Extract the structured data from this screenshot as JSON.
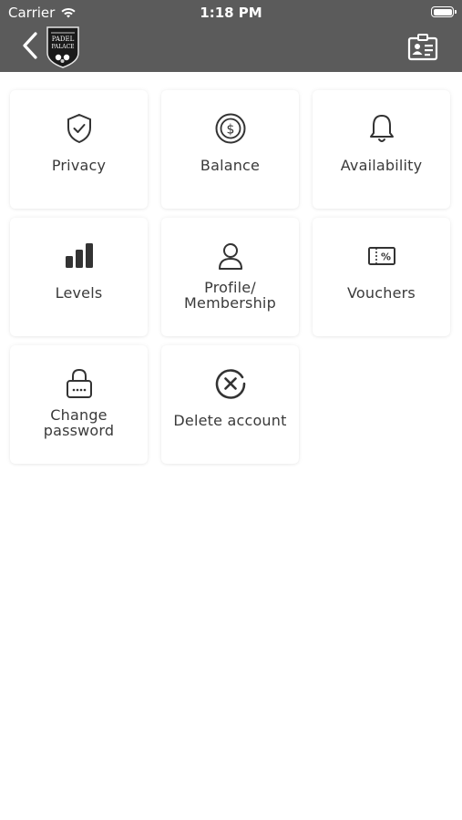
{
  "status_bar": {
    "carrier": "Carrier",
    "time": "1:18 PM"
  },
  "header": {
    "background_color": "#5b5b5b",
    "logo_alt": "Padel Palace",
    "back_icon": "chevron-left-icon",
    "right_icon": "id-card-icon"
  },
  "menu": {
    "privacy": "Privacy",
    "balance": "Balance",
    "availability": "Availability",
    "levels": "Levels",
    "profile_line1": "Profile/",
    "profile_line2": "Membership",
    "vouchers": "Vouchers",
    "change_password_line1": "Change",
    "change_password_line2": "password",
    "delete_account": "Delete account"
  }
}
